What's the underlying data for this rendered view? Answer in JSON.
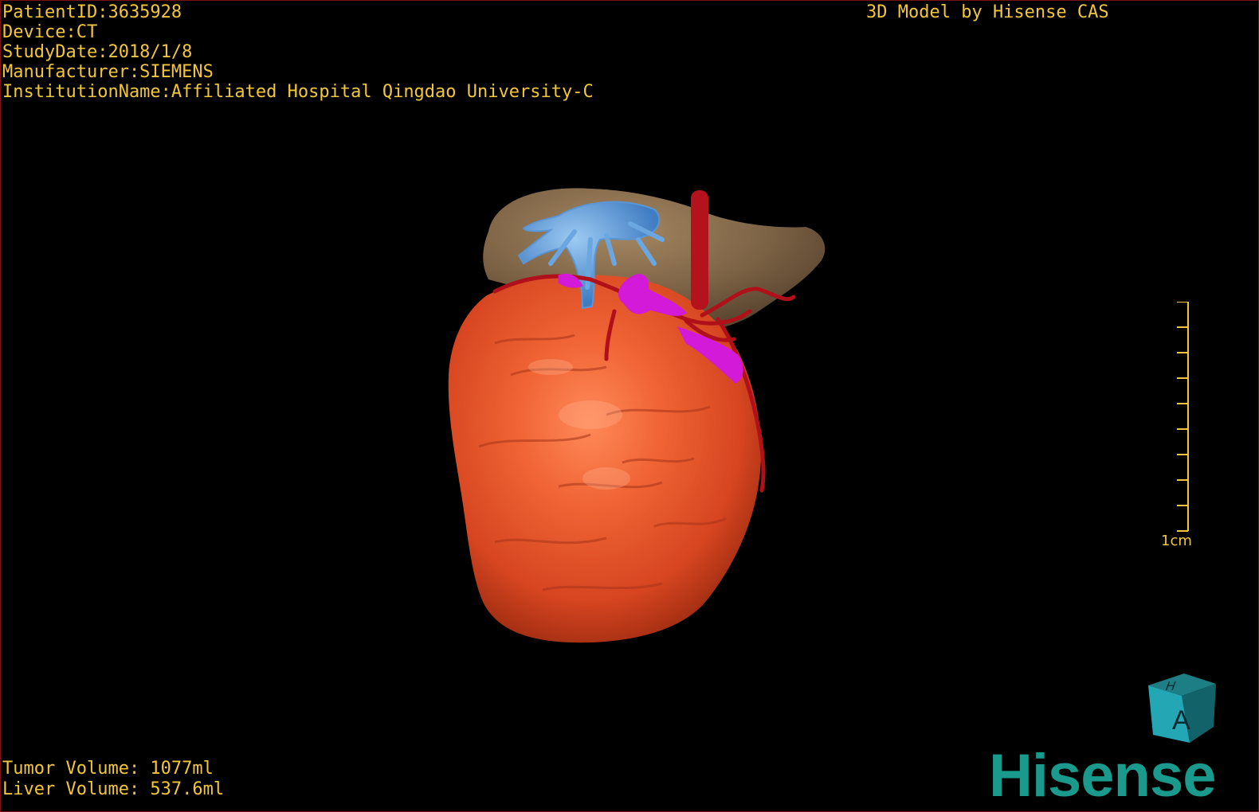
{
  "header": {
    "patient_id": "PatientID:3635928",
    "device": "Device:CT",
    "study_date": "StudyDate:2018/1/8",
    "manufacturer": "Manufacturer:SIEMENS",
    "institution": "InstitutionName:Affiliated Hospital Qingdao University-C"
  },
  "credit": "3D Model by Hisense CAS",
  "volumes": {
    "tumor": "Tumor Volume: 1077ml",
    "liver": "Liver Volume: 537.6ml"
  },
  "scale": {
    "label": "1cm"
  },
  "orientation_cube": {
    "front_letter": "A",
    "top_letter": "H"
  },
  "brand": "Hisense",
  "colors": {
    "overlay_text": "#f2c63a",
    "tumor": "#e8552a",
    "liver": "#8a6e4e",
    "portal_vein": "#6aa6e0",
    "hepatic_vein": "#d21ad8",
    "artery": "#b0101a",
    "brand": "#1a9a8c"
  }
}
